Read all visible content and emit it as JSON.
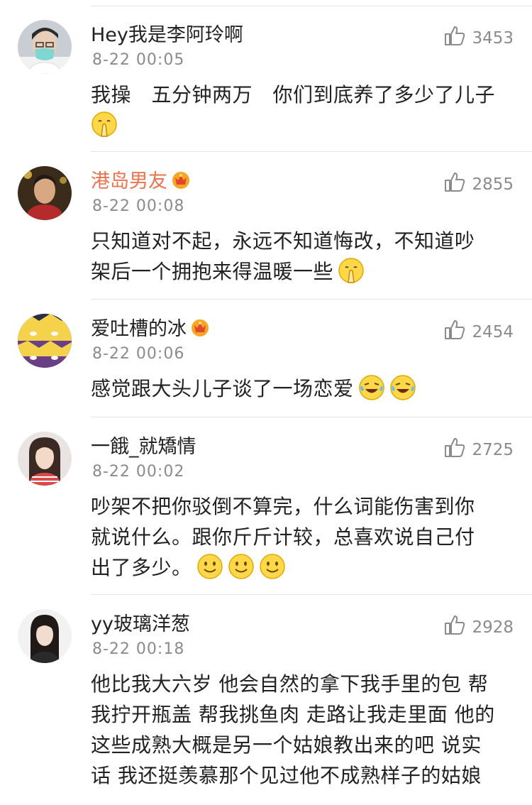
{
  "comments": [
    {
      "username": "Hey我是李阿玲啊",
      "vip": false,
      "time": "8-22 00:05",
      "likes": "3453",
      "lines": [
        "我操　五分钟两万　你们到底养了多少了儿子"
      ],
      "emojis": [
        "praying-emoji"
      ]
    },
    {
      "username": "港岛男友",
      "vip": true,
      "time": "8-22 00:08",
      "likes": "2855",
      "lines": [
        "只知道对不起，永远不知道悔改，不知道吵",
        "架后一个拥抱来得温暖一些"
      ],
      "emojis": [
        "praying-emoji"
      ]
    },
    {
      "username": "爱吐槽的冰",
      "vip": true,
      "time": "8-22 00:06",
      "likes": "2454",
      "lines": [
        "感觉跟大头儿子谈了一场恋爱"
      ],
      "emojis": [
        "laughing-tears-emoji",
        "laughing-tears-emoji"
      ]
    },
    {
      "username": "一餓_就矯情",
      "vip": false,
      "time": "8-22 00:02",
      "likes": "2725",
      "lines": [
        "吵架不把你驳倒不算完，什么词能伤害到你",
        "就说什么。跟你斤斤计较，总喜欢说自己付",
        "出了多少。"
      ],
      "emojis": [
        "smile-emoji",
        "smile-emoji",
        "smile-emoji"
      ]
    },
    {
      "username": "yy玻璃洋葱",
      "vip": false,
      "time": "8-22 00:18",
      "likes": "2928",
      "lines": [
        "他比我大六岁 他会自然的拿下我手里的包 帮",
        "我拧开瓶盖 帮我挑鱼肉 走路让我走里面 他的",
        "这些成熟大概是另一个姑娘教出来的吧 说实",
        "话 我还挺羡慕那个见过他不成熟样子的姑娘"
      ],
      "emojis": []
    }
  ],
  "colors": {
    "vip_name": "#eb7350",
    "meta": "#8b8b8b",
    "divider": "#e3e3e3"
  },
  "icons": {
    "like": "thumbs-up-icon",
    "vip": "vip-crown-badge-icon"
  }
}
